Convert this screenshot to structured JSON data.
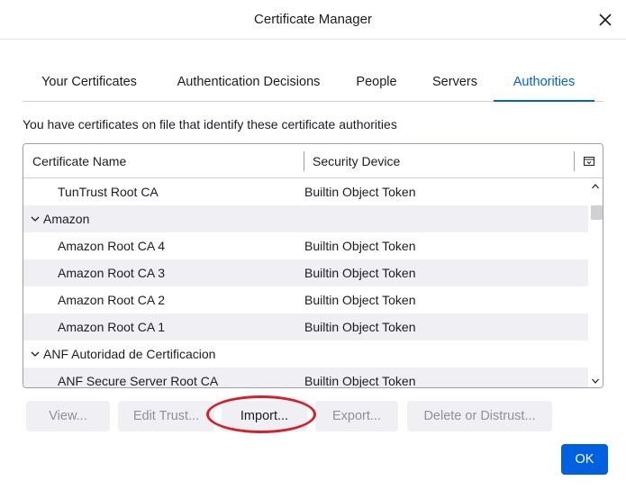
{
  "window": {
    "title": "Certificate Manager"
  },
  "tabs": [
    {
      "label": "Your Certificates",
      "selected": false
    },
    {
      "label": "Authentication Decisions",
      "selected": false
    },
    {
      "label": "People",
      "selected": false
    },
    {
      "label": "Servers",
      "selected": false
    },
    {
      "label": "Authorities",
      "selected": true
    }
  ],
  "intro_text": "You have certificates on file that identify these certificate authorities",
  "tree": {
    "columns": [
      "Certificate Name",
      "Security Device"
    ],
    "rows": [
      {
        "type": "cert",
        "name": "TunTrust Root CA",
        "device": "Builtin Object Token"
      },
      {
        "type": "group",
        "name": "Amazon",
        "device": ""
      },
      {
        "type": "cert",
        "name": "Amazon Root CA 4",
        "device": "Builtin Object Token"
      },
      {
        "type": "cert",
        "name": "Amazon Root CA 3",
        "device": "Builtin Object Token"
      },
      {
        "type": "cert",
        "name": "Amazon Root CA 2",
        "device": "Builtin Object Token"
      },
      {
        "type": "cert",
        "name": "Amazon Root CA 1",
        "device": "Builtin Object Token"
      },
      {
        "type": "group",
        "name": "ANF Autoridad de Certificacion",
        "device": ""
      },
      {
        "type": "cert",
        "name": "ANF Secure Server Root CA",
        "device": "Builtin Object Token"
      }
    ]
  },
  "buttons": {
    "view": "View...",
    "edit_trust": "Edit Trust...",
    "import": "Import...",
    "export": "Export...",
    "delete": "Delete or Distrust...",
    "ok": "OK"
  },
  "colors": {
    "accent": "#0061e0",
    "highlight_ring": "#d4202a",
    "row_stripe": "#f0f0f4"
  },
  "icons": [
    "close-icon",
    "column-picker-icon",
    "chevron-down-icon",
    "scroll-up-arrow-icon",
    "scroll-down-arrow-icon"
  ]
}
